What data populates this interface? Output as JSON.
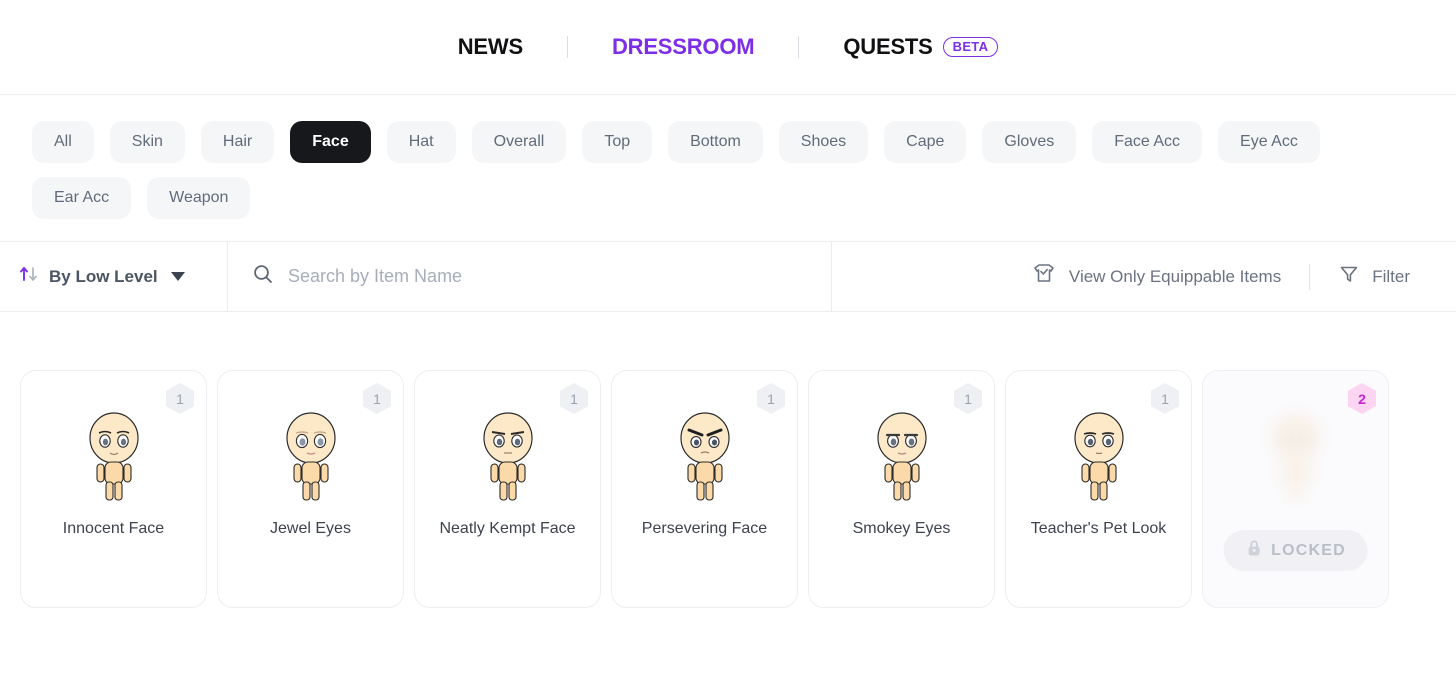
{
  "header": {
    "nav": [
      {
        "label": "NEWS",
        "active": false,
        "badge": null
      },
      {
        "label": "DRESSROOM",
        "active": true,
        "badge": null
      },
      {
        "label": "QUESTS",
        "active": false,
        "badge": "BETA"
      }
    ]
  },
  "categories": {
    "active": "Face",
    "items": [
      "All",
      "Skin",
      "Hair",
      "Face",
      "Hat",
      "Overall",
      "Top",
      "Bottom",
      "Shoes",
      "Cape",
      "Gloves",
      "Face Acc",
      "Eye Acc",
      "Ear Acc",
      "Weapon"
    ]
  },
  "toolbar": {
    "sort_label": "By Low Level",
    "search_placeholder": "Search by Item Name",
    "search_value": "",
    "equippable_label": "View Only Equippable Items",
    "filter_label": "Filter"
  },
  "items": [
    {
      "name": "Innocent Face",
      "level": "1",
      "locked": false
    },
    {
      "name": "Jewel Eyes",
      "level": "1",
      "locked": false
    },
    {
      "name": "Neatly Kempt Face",
      "level": "1",
      "locked": false
    },
    {
      "name": "Persevering Face",
      "level": "1",
      "locked": false
    },
    {
      "name": "Smokey Eyes",
      "level": "1",
      "locked": false
    },
    {
      "name": "Teacher's Pet Look",
      "level": "1",
      "locked": false
    },
    {
      "name": "",
      "level": "2",
      "locked": true,
      "locked_label": "LOCKED"
    }
  ],
  "colors": {
    "accent_purple": "#7d2fe8",
    "active_pill": "#17181c",
    "badge_pink": "#fbd5f2",
    "badge_pink_text": "#c026d3"
  }
}
